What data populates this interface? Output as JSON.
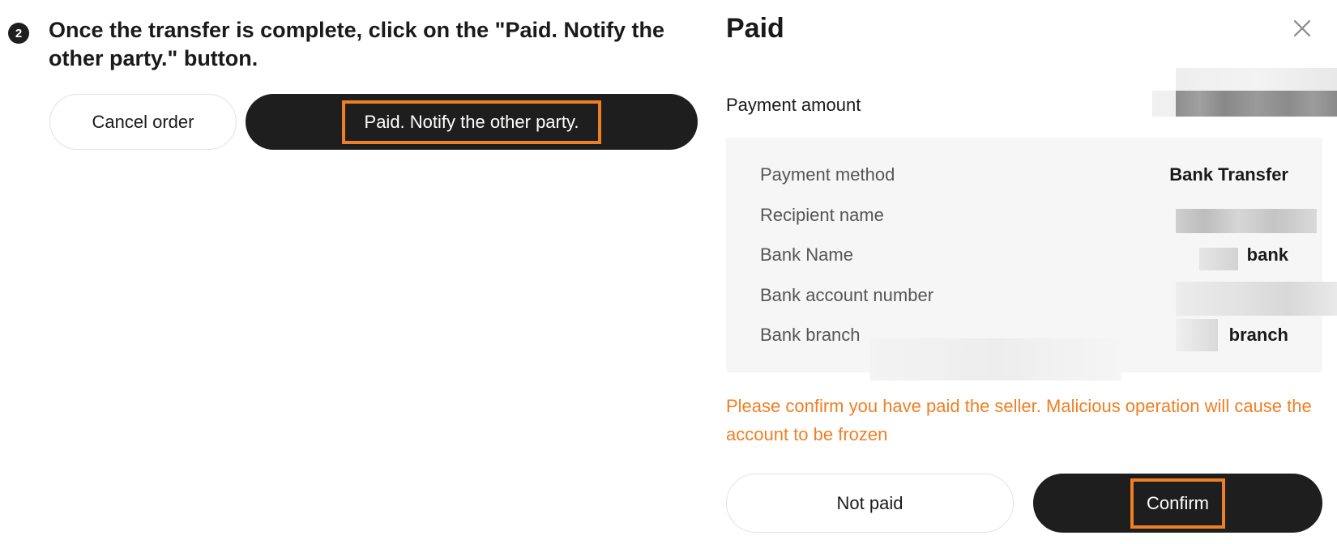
{
  "step": {
    "number": "2",
    "instruction": "Once the transfer is complete, click on the \"Paid. Notify the other party.\" button."
  },
  "order_actions": {
    "cancel_label": "Cancel order",
    "paid_notify_label": "Paid. Notify the other party."
  },
  "modal": {
    "title": "Paid",
    "close_icon": "close-icon",
    "payment_amount_label": "Payment amount",
    "details": [
      {
        "label": "Payment method",
        "value": "Bank Transfer"
      },
      {
        "label": "Recipient name",
        "value": ""
      },
      {
        "label": "Bank Name",
        "value": "bank"
      },
      {
        "label": "Bank account number",
        "value": ""
      },
      {
        "label": "Bank branch",
        "value": "branch"
      }
    ],
    "warning": "Please confirm you have paid the seller. Malicious operation will cause the account to be frozen",
    "not_paid_label": "Not paid",
    "confirm_label": "Confirm"
  },
  "colors": {
    "highlight": "#ef7f24",
    "dark_button": "#1e1e1e",
    "warning_text": "#ef7f24",
    "details_bg": "#f6f6f6"
  }
}
